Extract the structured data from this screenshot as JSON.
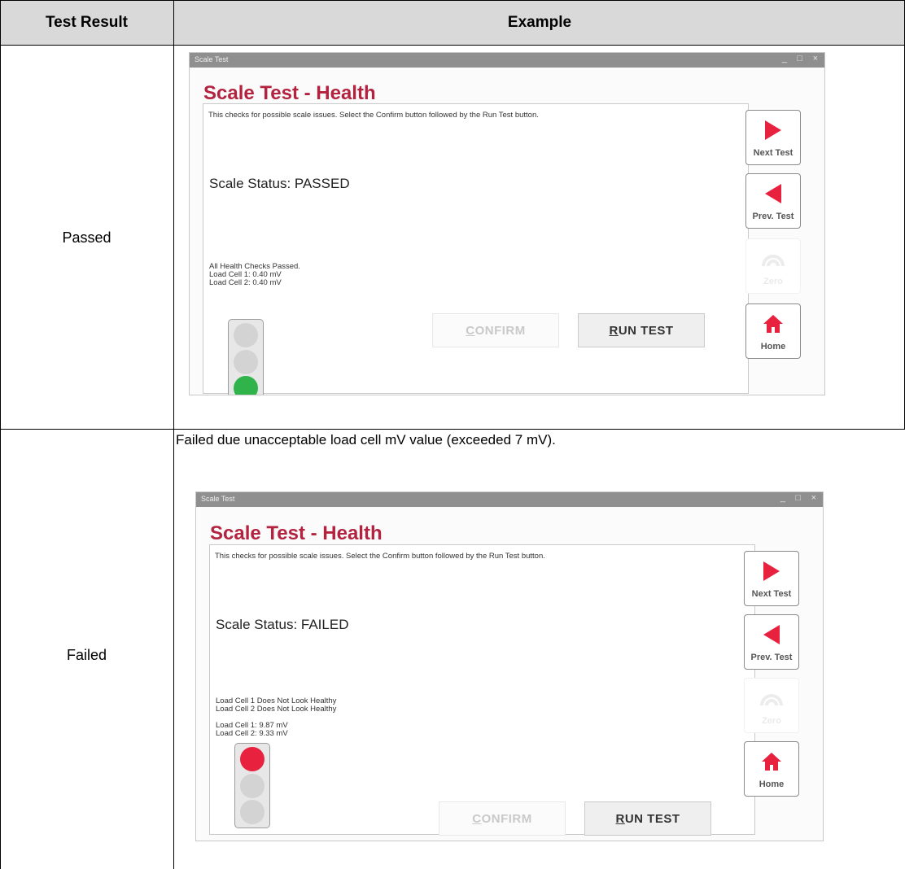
{
  "table": {
    "headers": {
      "result": "Test Result",
      "example": "Example"
    },
    "rows": [
      {
        "result": "Passed",
        "caption": "",
        "window": {
          "title_bar": "Scale Test",
          "controls": [
            "_",
            "□",
            "×"
          ],
          "app_title": "Scale Test - Health",
          "instruction": "This checks for possible scale issues. Select the Confirm button followed by the Run Test button.",
          "status": "Scale Status: PASSED",
          "details": [
            "All Health Checks Passed.",
            "Load Cell 1: 0.40 mV",
            "Load Cell 2: 0.40 mV"
          ],
          "light": "green",
          "confirm_rest": "ONFIRM",
          "confirm_key": "C",
          "run_key": "R",
          "run_rest": "UN TEST",
          "nav": {
            "next": "Next Test",
            "prev": "Prev. Test",
            "disabled": "Zero",
            "home": "Home"
          }
        }
      },
      {
        "result": "Failed",
        "caption": "Failed due unacceptable load cell mV value (exceeded 7 mV).",
        "window": {
          "title_bar": "Scale Test",
          "controls": [
            "_",
            "□",
            "×"
          ],
          "app_title": "Scale Test - Health",
          "instruction": "This checks for possible scale issues. Select the Confirm button followed by the Run Test button.",
          "status": "Scale Status: FAILED",
          "details": [
            "Load Cell 1 Does Not Look Healthy",
            "Load Cell 2 Does Not Look Healthy",
            "",
            "Load Cell 1: 9.87 mV",
            "Load Cell 2: 9.33 mV"
          ],
          "light": "red",
          "confirm_rest": "ONFIRM",
          "confirm_key": "C",
          "run_key": "R",
          "run_rest": "UN TEST",
          "nav": {
            "next": "Next Test",
            "prev": "Prev. Test",
            "disabled": "Zero",
            "home": "Home"
          }
        }
      }
    ]
  },
  "colors": {
    "header_bg": "#d9d9d9",
    "title": "#b32340",
    "accent": "#e8213f",
    "pass": "#2fb34a"
  }
}
